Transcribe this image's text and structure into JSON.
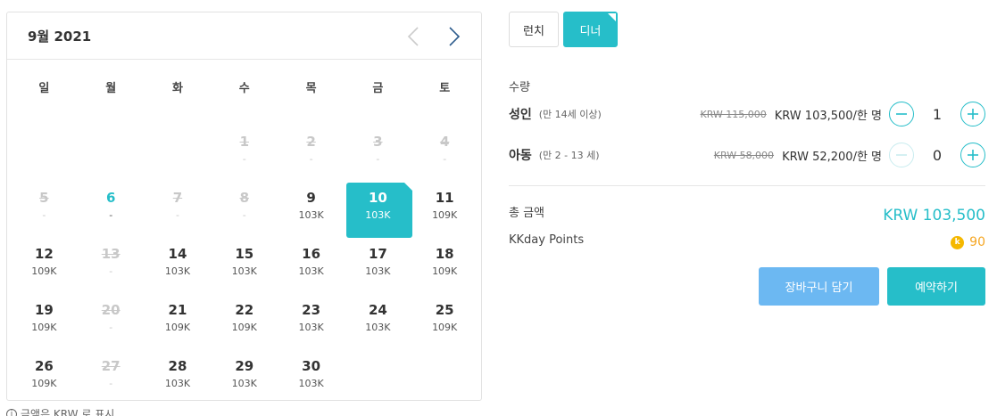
{
  "calendar": {
    "title": "9월 2021",
    "weekdays": [
      "일",
      "월",
      "화",
      "수",
      "목",
      "금",
      "토"
    ],
    "weeks": [
      [
        null,
        null,
        null,
        {
          "day": "1",
          "price": "-",
          "state": "disabled"
        },
        {
          "day": "2",
          "price": "-",
          "state": "disabled"
        },
        {
          "day": "3",
          "price": "-",
          "state": "disabled"
        },
        {
          "day": "4",
          "price": "-",
          "state": "disabled"
        }
      ],
      [
        {
          "day": "5",
          "price": "-",
          "state": "disabled"
        },
        {
          "day": "6",
          "price": "-",
          "state": "today"
        },
        {
          "day": "7",
          "price": "-",
          "state": "disabled"
        },
        {
          "day": "8",
          "price": "-",
          "state": "disabled"
        },
        {
          "day": "9",
          "price": "103K",
          "state": "available"
        },
        {
          "day": "10",
          "price": "103K",
          "state": "selected"
        },
        {
          "day": "11",
          "price": "109K",
          "state": "available"
        }
      ],
      [
        {
          "day": "12",
          "price": "109K",
          "state": "available"
        },
        {
          "day": "13",
          "price": "-",
          "state": "disabled"
        },
        {
          "day": "14",
          "price": "103K",
          "state": "available"
        },
        {
          "day": "15",
          "price": "103K",
          "state": "available"
        },
        {
          "day": "16",
          "price": "103K",
          "state": "available"
        },
        {
          "day": "17",
          "price": "103K",
          "state": "available"
        },
        {
          "day": "18",
          "price": "109K",
          "state": "available"
        }
      ],
      [
        {
          "day": "19",
          "price": "109K",
          "state": "available"
        },
        {
          "day": "20",
          "price": "-",
          "state": "disabled"
        },
        {
          "day": "21",
          "price": "109K",
          "state": "available"
        },
        {
          "day": "22",
          "price": "109K",
          "state": "available"
        },
        {
          "day": "23",
          "price": "103K",
          "state": "available"
        },
        {
          "day": "24",
          "price": "103K",
          "state": "available"
        },
        {
          "day": "25",
          "price": "109K",
          "state": "available"
        }
      ],
      [
        {
          "day": "26",
          "price": "109K",
          "state": "available"
        },
        {
          "day": "27",
          "price": "-",
          "state": "disabled"
        },
        {
          "day": "28",
          "price": "103K",
          "state": "available"
        },
        {
          "day": "29",
          "price": "103K",
          "state": "available"
        },
        {
          "day": "30",
          "price": "103K",
          "state": "available"
        },
        null,
        null
      ]
    ],
    "footnote": "금액은 KRW 로 표시"
  },
  "meal_tabs": [
    {
      "label": "런치",
      "active": false
    },
    {
      "label": "디너",
      "active": true
    }
  ],
  "quantity": {
    "title": "수량",
    "rows": [
      {
        "label": "성인",
        "sub": "(만 14세 이상)",
        "old_price": "KRW 115,000",
        "price": "KRW 103,500/한 명",
        "value": "1",
        "minus_enabled": true
      },
      {
        "label": "아동",
        "sub": "(만 2 - 13 세)",
        "old_price": "KRW 58,000",
        "price": "KRW 52,200/한 명",
        "value": "0",
        "minus_enabled": false
      }
    ]
  },
  "total": {
    "label": "총 금액",
    "value": "KRW 103,500"
  },
  "points": {
    "label": "KKday Points",
    "coin": "k",
    "value": "90"
  },
  "buttons": {
    "cart": "장바구니 담기",
    "book": "예약하기"
  },
  "colors": {
    "accent": "#26bec9",
    "cart_button": "#6cb8f2",
    "coin": "#f5b800"
  }
}
